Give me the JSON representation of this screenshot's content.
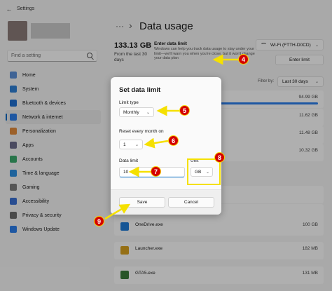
{
  "window": {
    "back_glyph": "←",
    "title": "Settings"
  },
  "sidebar": {
    "search_placeholder": "Find a setting",
    "items": [
      {
        "label": "Home",
        "icon": "home-icon",
        "color": "#5b8fd6"
      },
      {
        "label": "System",
        "icon": "system-icon",
        "color": "#2f7fd3"
      },
      {
        "label": "Bluetooth & devices",
        "icon": "bluetooth-icon",
        "color": "#1f6fd0"
      },
      {
        "label": "Network & internet",
        "icon": "network-icon",
        "color": "#2b7de9"
      },
      {
        "label": "Personalization",
        "icon": "personalization-icon",
        "color": "#e08a3c"
      },
      {
        "label": "Apps",
        "icon": "apps-icon",
        "color": "#6a6a8a"
      },
      {
        "label": "Accounts",
        "icon": "accounts-icon",
        "color": "#3aa86b"
      },
      {
        "label": "Time & language",
        "icon": "time-language-icon",
        "color": "#2b8fe0"
      },
      {
        "label": "Gaming",
        "icon": "gaming-icon",
        "color": "#7a7a7a"
      },
      {
        "label": "Accessibility",
        "icon": "accessibility-icon",
        "color": "#3a6fd0"
      },
      {
        "label": "Privacy & security",
        "icon": "privacy-shield-icon",
        "color": "#6a6a6a"
      },
      {
        "label": "Windows Update",
        "icon": "windows-update-icon",
        "color": "#2b7de9"
      }
    ],
    "active_index": 3
  },
  "main": {
    "breadcrumb_dots": "···",
    "breadcrumb_sep": "›",
    "title": "Data usage",
    "usage_total": "133.13 GB",
    "usage_period": "From the last 30 days",
    "limit_heading": "Enter data limit",
    "limit_description": "Windows can help you track data usage to stay under your limit—we'll warn you when you're close, but it won't change your data plan",
    "network_select": "Wi-Fi (FTTH-D0CD)",
    "enter_limit_label": "Enter limit",
    "filter_label": "Filter by:",
    "filter_value": "Last 30 days",
    "apps": [
      {
        "name": "",
        "size": "94.99 GB",
        "fill": 1.0
      },
      {
        "name": "",
        "size": "11.62 GB",
        "fill": 0
      },
      {
        "name": "",
        "size": "11.48 GB",
        "fill": 0
      },
      {
        "name": "",
        "size": "10.32 GB",
        "fill": 0
      },
      {
        "name": "",
        "size": "",
        "fill": 0
      },
      {
        "name": "",
        "size": "",
        "fill": 0
      },
      {
        "name": "OneDrive.exe",
        "size": "100 GB",
        "fill": 0,
        "icon": "onedrive-icon"
      },
      {
        "name": "Launcher.exe",
        "size": "182 MB",
        "fill": 0,
        "icon": "launcher-icon"
      },
      {
        "name": "GTA5.exe",
        "size": "131 MB",
        "fill": 0,
        "icon": "gta5-icon"
      }
    ]
  },
  "dialog": {
    "title": "Set data limit",
    "limit_type_label": "Limit type",
    "limit_type_value": "Monthly",
    "reset_label": "Reset every month on",
    "reset_value": "1",
    "data_limit_label": "Data limit",
    "data_limit_value": "10",
    "unit_label": "Unit",
    "unit_value": "GB",
    "save_label": "Save",
    "cancel_label": "Cancel"
  },
  "annotations": {
    "colors": {
      "badge": "#d40000",
      "arrow": "#f5e000"
    },
    "badges": [
      "4",
      "5",
      "6",
      "7",
      "8",
      "9"
    ]
  },
  "colors": {
    "accent": "#0067c0",
    "bar": "#2b7de9"
  }
}
